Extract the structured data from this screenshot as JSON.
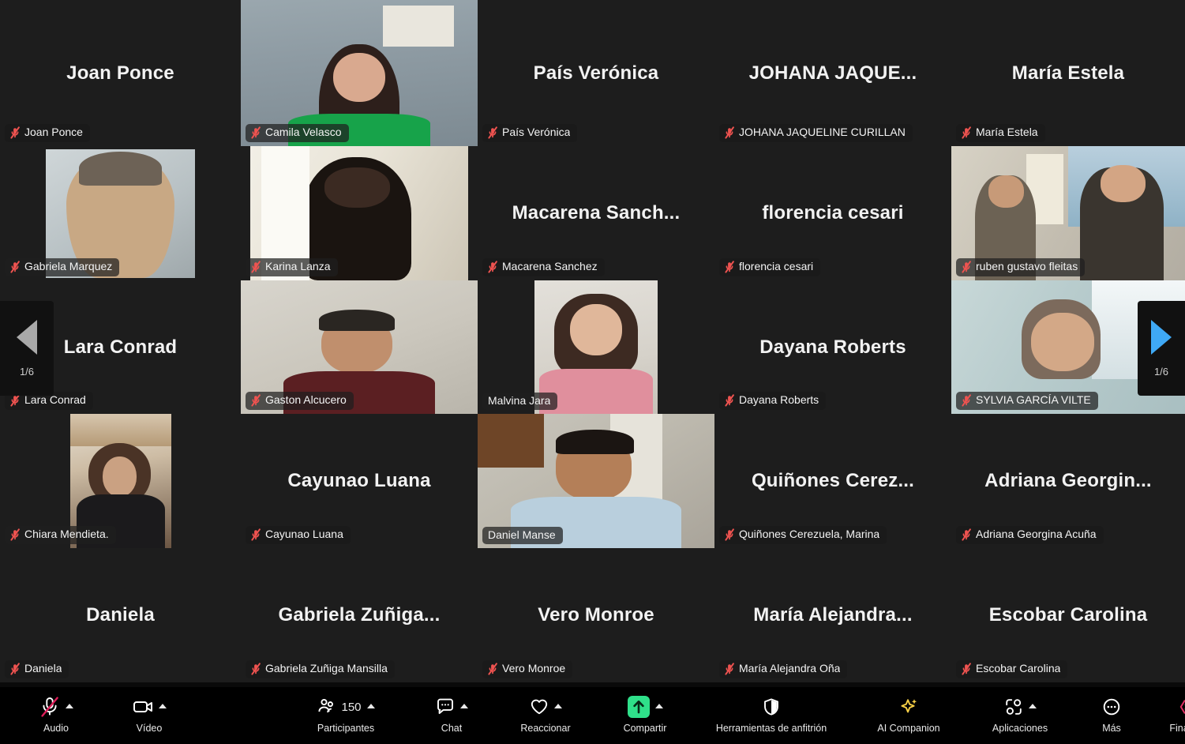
{
  "meeting": {
    "layout": "gallery",
    "columns": 5,
    "rows": 5,
    "active_speaker": "Daniel Manse",
    "active_border_color": "#3cdd8a"
  },
  "page_nav": {
    "prev": {
      "icon": "triangle-left-icon",
      "page_indicator": "1/6",
      "color": "#a9a9a9"
    },
    "next": {
      "icon": "triangle-right-icon",
      "page_indicator": "1/6",
      "color": "#3fa9f5"
    }
  },
  "tiles": [
    {
      "display_name": "Joan Ponce",
      "name_label": "Joan Ponce",
      "muted": true,
      "video": false,
      "active": false
    },
    {
      "display_name": "Camila Velasco",
      "name_label": "Camila Velasco",
      "muted": true,
      "video": true,
      "active": false,
      "video_style": "camila"
    },
    {
      "display_name": "País Verónica",
      "name_label": "País Verónica",
      "muted": true,
      "video": false,
      "active": false
    },
    {
      "display_name": "JOHANA  JAQUE...",
      "name_label": "JOHANA JAQUELINE CURILLAN",
      "muted": true,
      "video": false,
      "active": false
    },
    {
      "display_name": "María Estela",
      "name_label": "María Estela",
      "muted": true,
      "video": false,
      "active": false
    },
    {
      "display_name": "",
      "name_label": "Gabriela Marquez",
      "muted": true,
      "video": true,
      "active": false,
      "video_style": "gabriela"
    },
    {
      "display_name": "",
      "name_label": "Karina Lanza",
      "muted": true,
      "video": true,
      "active": false,
      "video_style": "karina"
    },
    {
      "display_name": "Macarena  Sanch...",
      "name_label": "Macarena Sanchez",
      "muted": true,
      "video": false,
      "active": false
    },
    {
      "display_name": "florencia cesari",
      "name_label": "florencia cesari",
      "muted": true,
      "video": false,
      "active": false
    },
    {
      "display_name": "",
      "name_label": "ruben gustavo fleitas",
      "muted": true,
      "video": true,
      "active": false,
      "video_style": "ruben"
    },
    {
      "display_name": "Lara Conrad",
      "name_label": "Lara Conrad",
      "muted": true,
      "video": false,
      "active": false
    },
    {
      "display_name": "",
      "name_label": "Gaston Alcucero",
      "muted": true,
      "video": true,
      "active": false,
      "video_style": "gaston"
    },
    {
      "display_name": "",
      "name_label": "Malvina Jara",
      "muted": false,
      "video": true,
      "active": false,
      "video_style": "malvina"
    },
    {
      "display_name": "Dayana Roberts",
      "name_label": "Dayana Roberts",
      "muted": true,
      "video": false,
      "active": false
    },
    {
      "display_name": "",
      "name_label": "SYLVIA GARCÍA VILTE",
      "muted": true,
      "video": true,
      "active": false,
      "video_style": "sylvia"
    },
    {
      "display_name": "",
      "name_label": "Chiara Mendieta.",
      "muted": true,
      "video": true,
      "active": false,
      "video_style": "chiara"
    },
    {
      "display_name": "Cayunao Luana",
      "name_label": "Cayunao Luana",
      "muted": true,
      "video": false,
      "active": false
    },
    {
      "display_name": "",
      "name_label": "Daniel Manse",
      "muted": false,
      "video": true,
      "active": true,
      "video_style": "daniel"
    },
    {
      "display_name": "Quiñones  Cerez...",
      "name_label": "Quiñones Cerezuela, Marina",
      "muted": true,
      "video": false,
      "active": false
    },
    {
      "display_name": "Adriana  Georgin...",
      "name_label": "Adriana Georgina Acuña",
      "muted": true,
      "video": false,
      "active": false
    },
    {
      "display_name": "Daniela",
      "name_label": "Daniela",
      "muted": true,
      "video": false,
      "active": false
    },
    {
      "display_name": "Gabriela  Zuñiga...",
      "name_label": "Gabriela Zuñiga Mansilla",
      "muted": true,
      "video": false,
      "active": false
    },
    {
      "display_name": "Vero Monroe",
      "name_label": "Vero Monroe",
      "muted": true,
      "video": false,
      "active": false
    },
    {
      "display_name": "María  Alejandra...",
      "name_label": "María Alejandra Oña",
      "muted": true,
      "video": false,
      "active": false
    },
    {
      "display_name": "Escobar Carolina",
      "name_label": "Escobar Carolina",
      "muted": true,
      "video": false,
      "active": false
    }
  ],
  "toolbar": {
    "audio": {
      "label": "Audio",
      "icon": "microphone-muted-icon",
      "has_caret": true,
      "state": "muted",
      "slash_color": "#e01e5a"
    },
    "video": {
      "label": "Vídeo",
      "icon": "camera-icon",
      "has_caret": true
    },
    "participants": {
      "label": "Participantes",
      "icon": "people-icon",
      "count": "150",
      "has_caret": true
    },
    "chat": {
      "label": "Chat",
      "icon": "chat-bubble-icon",
      "has_caret": true
    },
    "react": {
      "label": "Reaccionar",
      "icon": "heart-icon",
      "has_caret": true
    },
    "share": {
      "label": "Compartir",
      "icon": "share-up-arrow-icon",
      "has_caret": true,
      "accent": "#2fe08a"
    },
    "host_tools": {
      "label": "Herramientas de anfitrión",
      "icon": "shield-icon",
      "has_caret": false
    },
    "ai_companion": {
      "label": "AI Companion",
      "icon": "sparkle-icon",
      "has_caret": false,
      "accent": "#f7d046"
    },
    "apps": {
      "label": "Aplicaciones",
      "icon": "apps-icon",
      "has_caret": true
    },
    "more": {
      "label": "Más",
      "icon": "ellipsis-circle-icon",
      "has_caret": false
    },
    "end": {
      "label": "Finalizar",
      "icon": "end-call-hexagon-icon",
      "accent": "#e02d60"
    }
  }
}
